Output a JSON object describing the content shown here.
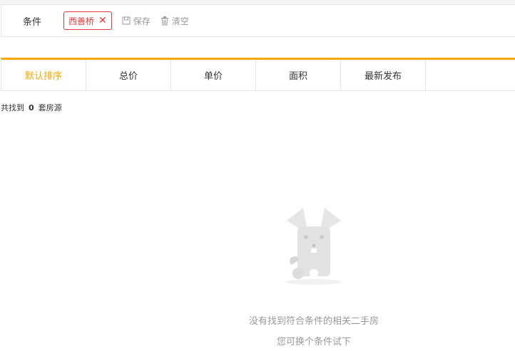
{
  "filter": {
    "label": "条件",
    "chip": "西善桥",
    "save": "保存",
    "clear": "清空"
  },
  "sort": {
    "tabs": [
      {
        "label": "默认排序",
        "active": true
      },
      {
        "label": "总价"
      },
      {
        "label": "单价"
      },
      {
        "label": "面积"
      },
      {
        "label": "最新发布"
      }
    ]
  },
  "result": {
    "prefix": "共找到",
    "count": "0",
    "suffix": "套房源"
  },
  "empty": {
    "line1": "没有找到符合条件的相关二手房",
    "line2": "您可换个条件试下"
  },
  "colors": {
    "accent": "#f8a800",
    "chip": "#e4393c"
  }
}
